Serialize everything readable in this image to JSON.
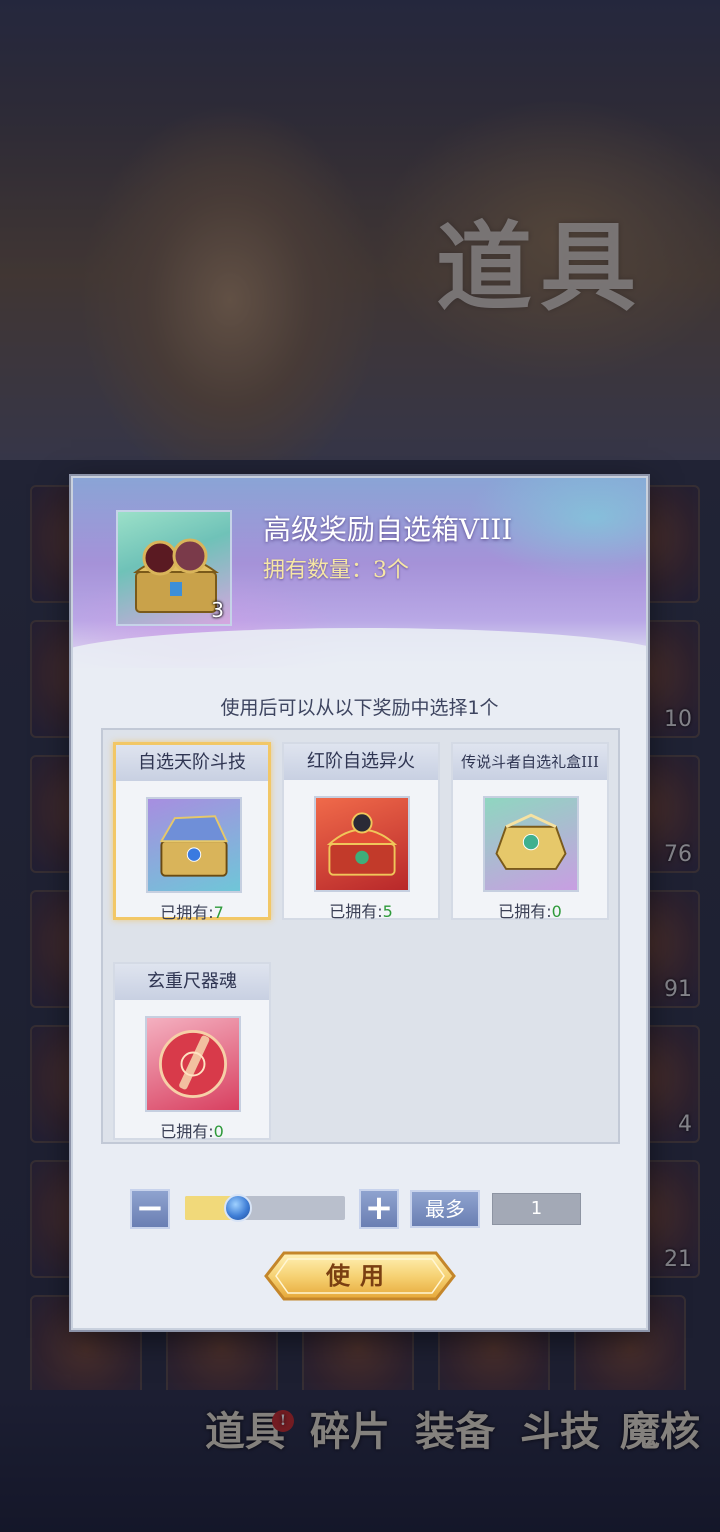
{
  "background": {
    "banner_title": "道具",
    "grid_counts": [
      "10",
      "76",
      "91",
      "4",
      "21"
    ],
    "tabs": [
      {
        "label": "道具",
        "active": true,
        "badge": "!"
      },
      {
        "label": "碎片",
        "active": false
      },
      {
        "label": "装备",
        "active": false
      },
      {
        "label": "斗技",
        "active": false
      },
      {
        "label": "魔核",
        "active": false
      }
    ]
  },
  "modal": {
    "item": {
      "title": "高级奖励自选箱VIII",
      "quantity_text": "拥有数量：3个",
      "icon_count": "3",
      "icon": "treasure-chest-icon"
    },
    "instruction": "使用后可以从以下奖励中选择1个",
    "rewards": [
      {
        "title": "自选天阶斗技",
        "owned_label": "已拥有:",
        "owned_count": "7",
        "selected": true,
        "icon": "skill-chest-icon",
        "color": "#b59be6"
      },
      {
        "title": "红阶自选异火",
        "owned_label": "已拥有:",
        "owned_count": "5",
        "selected": false,
        "icon": "fire-chest-icon",
        "color": "#e25545"
      },
      {
        "title": "传说斗者自选礼盒III",
        "owned_label": "已拥有:",
        "owned_count": "0",
        "selected": false,
        "icon": "legend-gift-box-icon",
        "color": "#9fd4c8"
      },
      {
        "title": "玄重尺器魂",
        "owned_label": "已拥有:",
        "owned_count": "0",
        "selected": false,
        "icon": "weapon-soul-icon",
        "color": "#e06a8a"
      }
    ],
    "quantity": {
      "minus": "−",
      "plus": "+",
      "max_label": "最多",
      "value": "1",
      "slider_fraction": 0.33
    },
    "use_button": "使用"
  },
  "colors": {
    "accent_gold": "#f2c766",
    "owned_green": "#2e9a3a",
    "button_blue": "#7a8fc3"
  }
}
